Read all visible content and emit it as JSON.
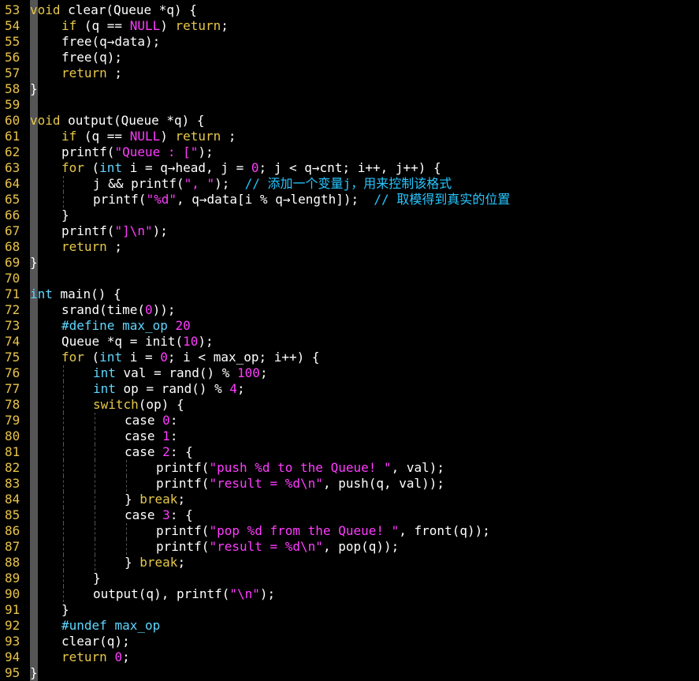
{
  "editor": {
    "colors": {
      "background": "#000000",
      "line_number": "#e8c34a",
      "keyword": "#e6c84a",
      "type": "#5fd7ff",
      "number": "#ff3cff",
      "string": "#ff3cff",
      "comment": "#27c6ff",
      "preprocessor": "#5fd7ff",
      "text": "#ffffff"
    },
    "lines": [
      {
        "no": "53",
        "indent": 0,
        "tokens": [
          [
            "kw",
            "void"
          ],
          [
            "id",
            " clear(Queue *q) {"
          ]
        ]
      },
      {
        "no": "54",
        "indent": 1,
        "tokens": [
          [
            "kw",
            "if"
          ],
          [
            "id",
            " (q == "
          ],
          [
            "num",
            "NULL"
          ],
          [
            "id",
            ") "
          ],
          [
            "kw",
            "return"
          ],
          [
            "id",
            ";"
          ]
        ]
      },
      {
        "no": "55",
        "indent": 1,
        "tokens": [
          [
            "id",
            "free(q→data);"
          ]
        ]
      },
      {
        "no": "56",
        "indent": 1,
        "tokens": [
          [
            "id",
            "free(q);"
          ]
        ]
      },
      {
        "no": "57",
        "indent": 1,
        "tokens": [
          [
            "kw",
            "return"
          ],
          [
            "id",
            " ;"
          ]
        ]
      },
      {
        "no": "58",
        "indent": 0,
        "tokens": [
          [
            "id",
            "}"
          ]
        ]
      },
      {
        "no": "59",
        "indent": 0,
        "tokens": []
      },
      {
        "no": "60",
        "indent": 0,
        "tokens": [
          [
            "kw",
            "void"
          ],
          [
            "id",
            " output(Queue *q) {"
          ]
        ]
      },
      {
        "no": "61",
        "indent": 1,
        "tokens": [
          [
            "kw",
            "if"
          ],
          [
            "id",
            " (q == "
          ],
          [
            "num",
            "NULL"
          ],
          [
            "id",
            ") "
          ],
          [
            "kw",
            "return"
          ],
          [
            "id",
            " ;"
          ]
        ]
      },
      {
        "no": "62",
        "indent": 1,
        "tokens": [
          [
            "id",
            "printf("
          ],
          [
            "str",
            "\"Queue : [\""
          ],
          [
            "id",
            ");"
          ]
        ]
      },
      {
        "no": "63",
        "indent": 1,
        "tokens": [
          [
            "kw",
            "for"
          ],
          [
            "id",
            " ("
          ],
          [
            "ty",
            "int"
          ],
          [
            "id",
            " i = q→head, j = "
          ],
          [
            "num",
            "0"
          ],
          [
            "id",
            "; j < q→cnt; i++, j++) {"
          ]
        ]
      },
      {
        "no": "64",
        "indent": 2,
        "tokens": [
          [
            "id",
            "j && printf("
          ],
          [
            "str",
            "\", \""
          ],
          [
            "id",
            ");  "
          ],
          [
            "cm",
            "// 添加一个变量j，用来控制该格式"
          ]
        ]
      },
      {
        "no": "65",
        "indent": 2,
        "tokens": [
          [
            "id",
            "printf("
          ],
          [
            "str",
            "\"%d\""
          ],
          [
            "id",
            ", q→data[i % q→length]);  "
          ],
          [
            "cm",
            "// 取模得到真实的位置"
          ]
        ]
      },
      {
        "no": "66",
        "indent": 1,
        "tokens": [
          [
            "id",
            "}"
          ]
        ]
      },
      {
        "no": "67",
        "indent": 1,
        "tokens": [
          [
            "id",
            "printf("
          ],
          [
            "str",
            "\"]\\n\""
          ],
          [
            "id",
            ");"
          ]
        ]
      },
      {
        "no": "68",
        "indent": 1,
        "tokens": [
          [
            "kw",
            "return"
          ],
          [
            "id",
            " ;"
          ]
        ]
      },
      {
        "no": "69",
        "indent": 0,
        "tokens": [
          [
            "id",
            "}"
          ]
        ]
      },
      {
        "no": "70",
        "indent": 0,
        "tokens": []
      },
      {
        "no": "71",
        "indent": 0,
        "tokens": [
          [
            "ty",
            "int"
          ],
          [
            "id",
            " main() {"
          ]
        ]
      },
      {
        "no": "72",
        "indent": 1,
        "tokens": [
          [
            "id",
            "srand(time("
          ],
          [
            "num",
            "0"
          ],
          [
            "id",
            "));"
          ]
        ]
      },
      {
        "no": "73",
        "indent": 1,
        "tokens": [
          [
            "pp",
            "#define"
          ],
          [
            "id",
            " "
          ],
          [
            "ty",
            "max_op"
          ],
          [
            "id",
            " "
          ],
          [
            "num",
            "20"
          ]
        ]
      },
      {
        "no": "74",
        "indent": 1,
        "tokens": [
          [
            "id",
            "Queue *q = init("
          ],
          [
            "num",
            "10"
          ],
          [
            "id",
            ");"
          ]
        ]
      },
      {
        "no": "75",
        "indent": 1,
        "tokens": [
          [
            "kw",
            "for"
          ],
          [
            "id",
            " ("
          ],
          [
            "ty",
            "int"
          ],
          [
            "id",
            " i = "
          ],
          [
            "num",
            "0"
          ],
          [
            "id",
            "; i < max_op; i++) {"
          ]
        ]
      },
      {
        "no": "76",
        "indent": 2,
        "tokens": [
          [
            "ty",
            "int"
          ],
          [
            "id",
            " val = rand() % "
          ],
          [
            "num",
            "100"
          ],
          [
            "id",
            ";"
          ]
        ]
      },
      {
        "no": "77",
        "indent": 2,
        "tokens": [
          [
            "ty",
            "int"
          ],
          [
            "id",
            " op = rand() % "
          ],
          [
            "num",
            "4"
          ],
          [
            "id",
            ";"
          ]
        ]
      },
      {
        "no": "78",
        "indent": 2,
        "tokens": [
          [
            "kw",
            "switch"
          ],
          [
            "id",
            "(op) {"
          ]
        ]
      },
      {
        "no": "79",
        "indent": 3,
        "tokens": [
          [
            "id",
            "case "
          ],
          [
            "num",
            "0"
          ],
          [
            "id",
            ":"
          ]
        ]
      },
      {
        "no": "80",
        "indent": 3,
        "tokens": [
          [
            "id",
            "case "
          ],
          [
            "num",
            "1"
          ],
          [
            "id",
            ":"
          ]
        ]
      },
      {
        "no": "81",
        "indent": 3,
        "tokens": [
          [
            "id",
            "case "
          ],
          [
            "num",
            "2"
          ],
          [
            "id",
            ": {"
          ]
        ]
      },
      {
        "no": "82",
        "indent": 4,
        "tokens": [
          [
            "id",
            "printf("
          ],
          [
            "str",
            "\"push %d to the Queue! \""
          ],
          [
            "id",
            ", val);"
          ]
        ]
      },
      {
        "no": "83",
        "indent": 4,
        "tokens": [
          [
            "id",
            "printf("
          ],
          [
            "str",
            "\"result = %d\\n\""
          ],
          [
            "id",
            ", push(q, val));"
          ]
        ]
      },
      {
        "no": "84",
        "indent": 3,
        "tokens": [
          [
            "id",
            "} "
          ],
          [
            "kw",
            "break"
          ],
          [
            "id",
            ";"
          ]
        ]
      },
      {
        "no": "85",
        "indent": 3,
        "tokens": [
          [
            "id",
            "case "
          ],
          [
            "num",
            "3"
          ],
          [
            "id",
            ": {"
          ]
        ]
      },
      {
        "no": "86",
        "indent": 4,
        "tokens": [
          [
            "id",
            "printf("
          ],
          [
            "str",
            "\"pop %d from the Queue! \""
          ],
          [
            "id",
            ", front(q));"
          ]
        ]
      },
      {
        "no": "87",
        "indent": 4,
        "tokens": [
          [
            "id",
            "printf("
          ],
          [
            "str",
            "\"result = %d\\n\""
          ],
          [
            "id",
            ", pop(q));"
          ]
        ]
      },
      {
        "no": "88",
        "indent": 3,
        "tokens": [
          [
            "id",
            "} "
          ],
          [
            "kw",
            "break"
          ],
          [
            "id",
            ";"
          ]
        ]
      },
      {
        "no": "89",
        "indent": 2,
        "tokens": [
          [
            "id",
            "}"
          ]
        ]
      },
      {
        "no": "90",
        "indent": 2,
        "tokens": [
          [
            "id",
            "output(q), printf("
          ],
          [
            "str",
            "\"\\n\""
          ],
          [
            "id",
            ");"
          ]
        ]
      },
      {
        "no": "91",
        "indent": 1,
        "tokens": [
          [
            "id",
            "}"
          ]
        ]
      },
      {
        "no": "92",
        "indent": 1,
        "tokens": [
          [
            "pp",
            "#undef"
          ],
          [
            "id",
            " "
          ],
          [
            "ty",
            "max_op"
          ]
        ]
      },
      {
        "no": "93",
        "indent": 1,
        "tokens": [
          [
            "id",
            "clear(q);"
          ]
        ]
      },
      {
        "no": "94",
        "indent": 1,
        "tokens": [
          [
            "kw",
            "return"
          ],
          [
            "id",
            " "
          ],
          [
            "num",
            "0"
          ],
          [
            "id",
            ";"
          ]
        ]
      },
      {
        "no": "95",
        "indent": 0,
        "tokens": [
          [
            "id",
            "}"
          ]
        ]
      }
    ]
  }
}
